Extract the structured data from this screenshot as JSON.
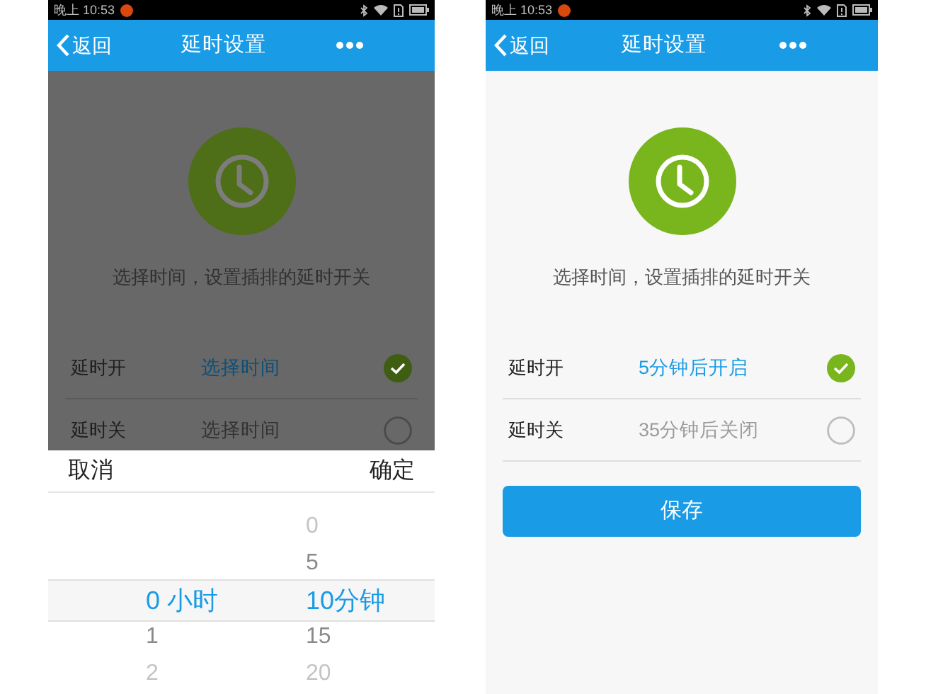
{
  "screens": [
    {
      "dimmed": true,
      "status_bar": {
        "time": "晚上 10:53"
      },
      "nav": {
        "back": "返回",
        "title": "延时设置"
      },
      "hint": "选择时间，设置插排的延时开关",
      "rows": [
        {
          "label": "延时开",
          "value": "选择时间",
          "checked": true
        },
        {
          "label": "延时关",
          "value": "选择时间",
          "checked": false
        }
      ],
      "picker": {
        "cancel": "取消",
        "confirm": "确定",
        "columns": [
          {
            "items": [
              {
                "text": "0 小时",
                "selected": true
              },
              {
                "text": "1",
                "selected": false
              },
              {
                "text": "2",
                "selected": false
              }
            ]
          },
          {
            "items": [
              {
                "text": "0",
                "selected": false
              },
              {
                "text": "5",
                "selected": false
              },
              {
                "text": "10分钟",
                "selected": true
              },
              {
                "text": "15",
                "selected": false
              },
              {
                "text": "20",
                "selected": false
              }
            ]
          }
        ]
      }
    },
    {
      "dimmed": false,
      "status_bar": {
        "time": "晚上 10:53"
      },
      "nav": {
        "back": "返回",
        "title": "延时设置"
      },
      "hint": "选择时间，设置插排的延时开关",
      "rows": [
        {
          "label": "延时开",
          "value": "5分钟后开启",
          "checked": true
        },
        {
          "label": "延时关",
          "value": "35分钟后关闭",
          "checked": false
        }
      ],
      "save_button": "保存"
    }
  ]
}
